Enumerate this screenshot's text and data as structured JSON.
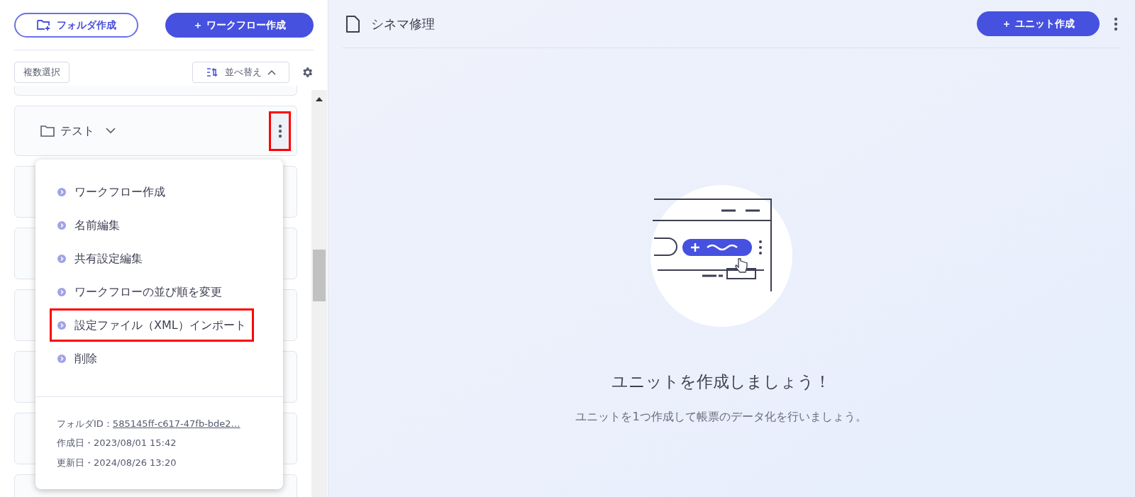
{
  "sidebar": {
    "create_folder_button": "フォルダ作成",
    "create_workflow_button": "＋ ワークフロー作成",
    "multi_select_button": "複数選択",
    "sort_button": "並べ替え",
    "folders": [
      {
        "name": "テスト",
        "menu_open": true,
        "highlighted": true
      }
    ],
    "menu": {
      "items": [
        {
          "label": "ワークフロー作成",
          "highlighted": false
        },
        {
          "label": "名前編集",
          "highlighted": false
        },
        {
          "label": "共有設定編集",
          "highlighted": false
        },
        {
          "label": "ワークフローの並び順を変更",
          "highlighted": false
        },
        {
          "label": "設定ファイル（XML）インポート",
          "highlighted": true
        },
        {
          "label": "削除",
          "highlighted": false
        }
      ],
      "folder_id_label": "フォルダID：",
      "folder_id": "585145ff-c617-47fb-bde2…",
      "created": "作成日・2023/08/01 15:42",
      "updated": "更新日・2024/08/26 13:20"
    }
  },
  "main": {
    "title": "シネマ修理",
    "create_unit_button": "＋ ユニット作成",
    "empty_heading": "ユニットを作成しましょう！",
    "empty_text": "ユニットを1つ作成して帳票のデータ化を行いましょう。"
  }
}
